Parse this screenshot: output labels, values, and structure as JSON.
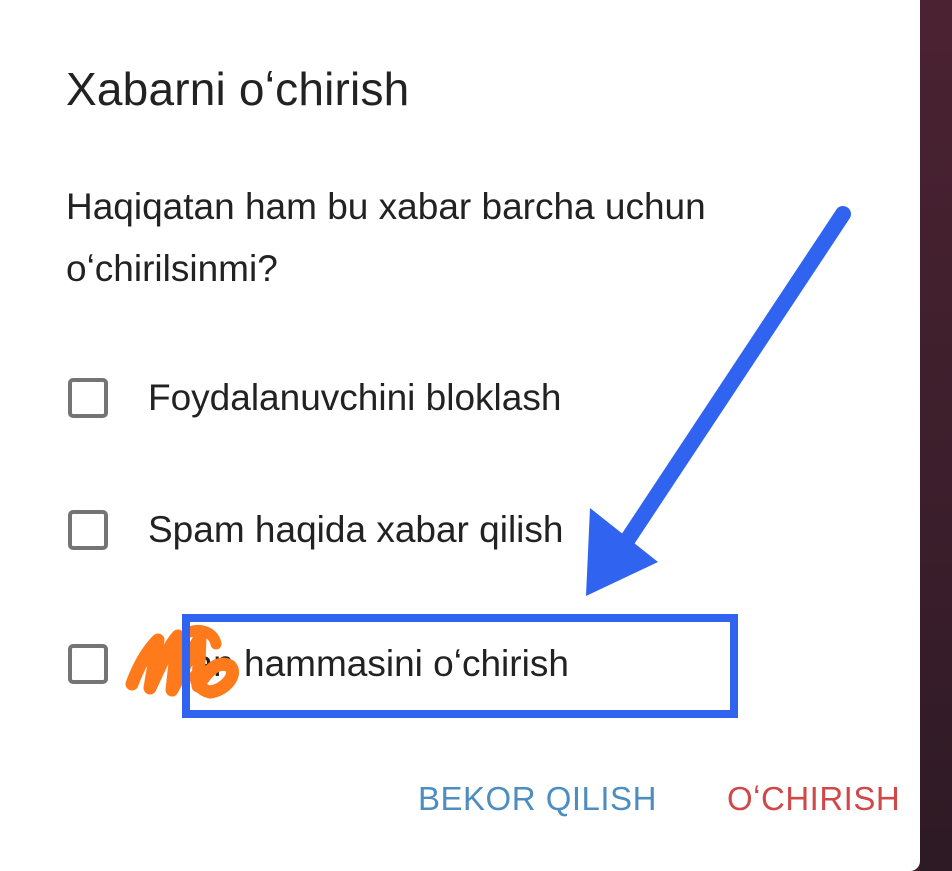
{
  "dialog": {
    "title": "Xabarni oʻchirish",
    "message": "Haqiqatan ham bu xabar barcha uchun oʻchirilsinmi?",
    "options": [
      {
        "label": "Foydalanuvchini bloklash",
        "checked": false
      },
      {
        "label": "Spam haqida xabar qilish",
        "checked": false
      },
      {
        "label": "dan hammasini oʻchirish",
        "checked": false
      }
    ],
    "cancel_label": "BEKOR QILISH",
    "delete_label": "OʻCHIRISH"
  },
  "colors": {
    "cancel": "#4d8dc0",
    "delete": "#d04848",
    "annotation_blue": "#2f63f0",
    "annotation_orange": "#ff7a1a"
  }
}
